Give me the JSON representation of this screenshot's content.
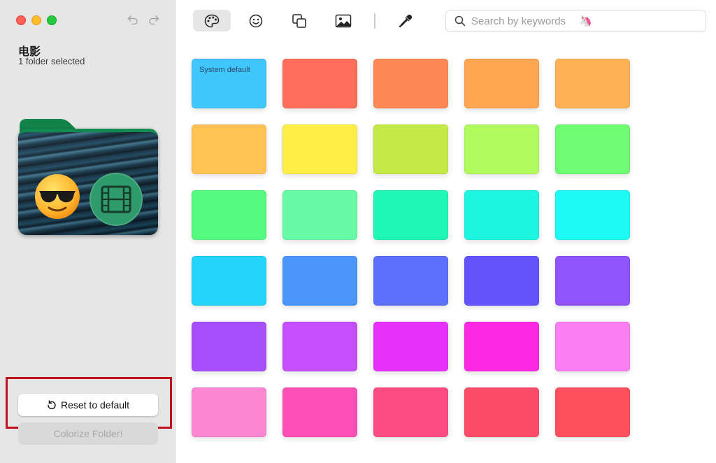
{
  "sidebar": {
    "title": "电影",
    "subtitle": "1 folder selected",
    "reset_label": "Reset to default",
    "colorize_label": "Colorize Folder!",
    "folder_color": "#138a4f",
    "badge_color": "#2f9a6a",
    "emoji_icon": "smiling-face-with-sunglasses",
    "badge_icon": "film-icon"
  },
  "toolbar": {
    "tools": [
      "palette-icon",
      "emoji-icon",
      "shapes-icon",
      "image-icon",
      "eyedropper-icon"
    ],
    "active_tool": "palette-icon"
  },
  "search": {
    "placeholder": "Search by keywords",
    "emoji": "🦄"
  },
  "swatches": {
    "default_label": "System default",
    "colors": [
      "#40c6fb",
      "#ff6e5a",
      "#ff8955",
      "#ffa653",
      "#ffb153",
      "#ffc453",
      "#ffee45",
      "#c4ea48",
      "#b2fb5f",
      "#6ffb73",
      "#54fb7e",
      "#67fba6",
      "#1ef7b6",
      "#1ef6e2",
      "#1efbf7",
      "#25d4fb",
      "#4b96fb",
      "#5c70fb",
      "#6253fb",
      "#8f55fb",
      "#a74ffb",
      "#c54ffb",
      "#e731fb",
      "#fb2ae2",
      "#fb7ef2",
      "#fc87d3",
      "#fc4fb5",
      "#fd4c84",
      "#fd4c6a",
      "#fd4f5e"
    ]
  },
  "highlight_color": "#c1121f"
}
